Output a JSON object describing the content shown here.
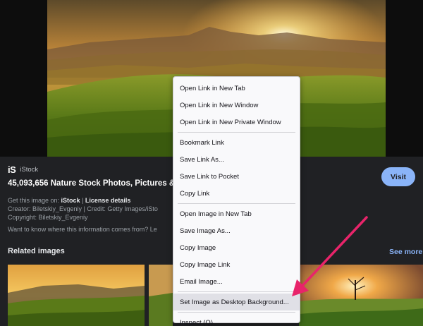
{
  "source": {
    "logo": "iS",
    "name": "iStock"
  },
  "title": "45,093,656 Nature Stock Photos, Pictures & I",
  "info": {
    "get_prefix": "Get this image on: ",
    "get_source": "iStock",
    "get_sep": " | ",
    "license": "License details",
    "creator": "Creator: Biletskiy_Evgeniy | Credit: Getty Images/iSto",
    "copyright": "Copyright: Biletskiy_Evgeniy"
  },
  "want_know": "Want to know where this information comes from? Le",
  "visit_label": "Visit",
  "related_heading": "Related images",
  "see_more": "See more",
  "menu": {
    "open_new_tab": "Open Link in New Tab",
    "open_new_window": "Open Link in New Window",
    "open_private": "Open Link in New Private Window",
    "bookmark": "Bookmark Link",
    "save_link": "Save Link As...",
    "save_pocket": "Save Link to Pocket",
    "copy_link": "Copy Link",
    "open_image": "Open Image in New Tab",
    "save_image": "Save Image As...",
    "copy_image": "Copy Image",
    "copy_image_link": "Copy Image Link",
    "email_image": "Email Image...",
    "set_background": "Set Image as Desktop Background...",
    "inspect": "Inspect (Q)"
  },
  "colors": {
    "accent": "#8ab4f8",
    "arrow": "#e8246a",
    "background": "#202124",
    "menu_bg": "#f9f9fb"
  }
}
